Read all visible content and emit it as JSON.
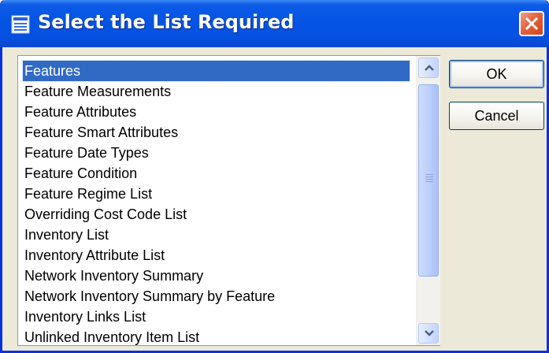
{
  "dialog": {
    "title": "Select the List Required",
    "icons": {
      "title": "list-window-icon",
      "close": "close-x-icon"
    }
  },
  "list": {
    "selected_index": 0,
    "items": [
      "Features",
      "Feature Measurements",
      "Feature Attributes",
      "Feature Smart Attributes",
      "Feature Date Types",
      "Feature Condition",
      "Feature Regime List",
      "Overriding Cost Code List",
      "Inventory List",
      "Inventory Attribute List",
      "Network Inventory Summary",
      "Network Inventory Summary by Feature",
      "Inventory Links List",
      "Unlinked Inventory Item List"
    ]
  },
  "buttons": {
    "ok": "OK",
    "cancel": "Cancel"
  },
  "colors": {
    "titlebar": "#0554e3",
    "selection": "#316ac5",
    "dialog_bg": "#ece9d8",
    "close_button": "#e4623e"
  }
}
